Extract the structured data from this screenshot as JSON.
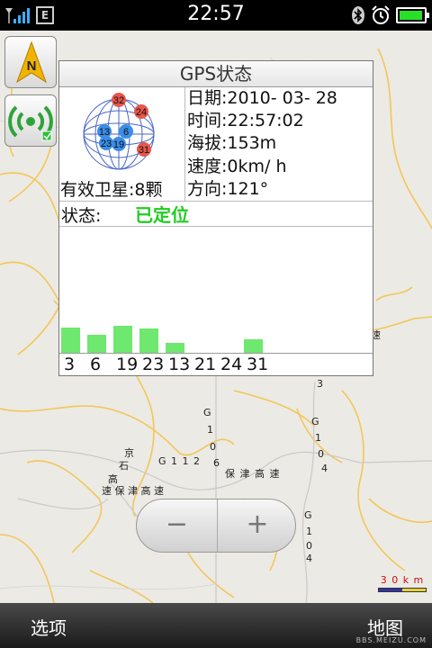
{
  "status_bar": {
    "time": "22:57",
    "network_icon": "signal-bars-icon",
    "data_icon_label": "E",
    "bluetooth_icon": "bluetooth-icon",
    "alarm_icon": "alarm-icon",
    "battery_level": 0.95,
    "battery_color": "#2adf2a"
  },
  "side_buttons": {
    "compass_label": "N",
    "gps_signal_icon": "gps-signal-icon"
  },
  "gps_panel": {
    "title": "GPS状态",
    "satellite_count": "有效卫星:8颗",
    "date": "日期:2010- 03- 28",
    "time": "时间:22:57:02",
    "altitude": "海拔:153m",
    "speed": "速度:0km/ h",
    "direction": "方向:121°",
    "status_label": "状态:",
    "status_value": "已定位",
    "status_color": "#22cc22",
    "sky_satellites": [
      {
        "id": "32",
        "color": "#e8564a"
      },
      {
        "id": "24",
        "color": "#e8564a"
      },
      {
        "id": "13",
        "color": "#3a8de8"
      },
      {
        "id": "6",
        "color": "#3a8de8"
      },
      {
        "id": "23",
        "color": "#3a8de8"
      },
      {
        "id": "19",
        "color": "#3a8de8"
      },
      {
        "id": "31",
        "color": "#e8564a"
      }
    ],
    "signal_bars": [
      {
        "label": "3",
        "strength": 0.7
      },
      {
        "label": "6",
        "strength": 0.5
      },
      {
        "label": "19",
        "strength": 0.75
      },
      {
        "label": "23",
        "strength": 0.68
      },
      {
        "label": "13",
        "strength": 0.28
      },
      {
        "label": "21",
        "strength": 0
      },
      {
        "label": "24",
        "strength": 0
      },
      {
        "label": "31",
        "strength": 0.37
      }
    ],
    "bar_color": "#6ee86e"
  },
  "map": {
    "labels": {
      "jing": "京",
      "shi": "石",
      "gao": "高",
      "road_g1": "G",
      "road_1": "1",
      "road_0": "0",
      "road_6": "6",
      "road_g112": "G 1 1 2",
      "baojin1": "保 津 高 速",
      "baojin2": "速 保 津 高 速",
      "g104_g": "G",
      "g104_1": "1",
      "g104_0": "0",
      "g104_4": "4",
      "right_3": "3",
      "right_0": "0",
      "right_su": "速",
      "g104b_g": "G",
      "g104b_1": "1",
      "g104b_0": "0",
      "g104b_4": "4"
    },
    "scale_text": "3 0 k m"
  },
  "zoom": {
    "zoom_out_label": "−",
    "zoom_in_label": "+"
  },
  "bottom_bar": {
    "left_label": "选项",
    "right_label": "地图",
    "watermark": "BBS.MEIZU.COM"
  }
}
